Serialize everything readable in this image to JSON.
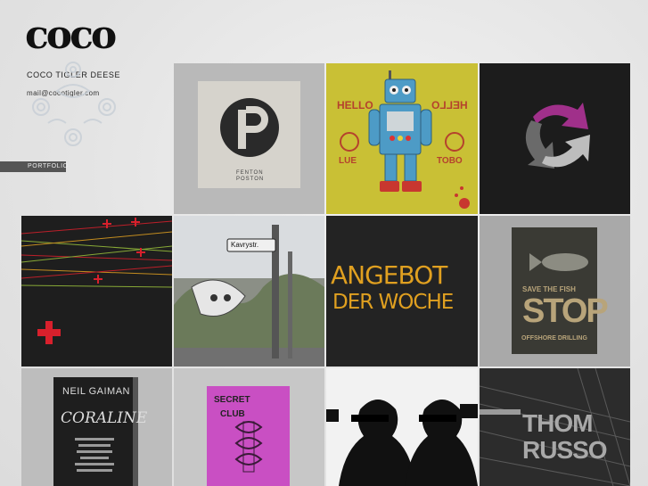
{
  "header": {
    "logo_text": "coco",
    "name": "COCO TIGLER DEESE",
    "email": "mail@cocotigler.com"
  },
  "nav": {
    "items": [
      {
        "label": "PORTFOLIO"
      }
    ]
  },
  "portfolio": {
    "fenton": {
      "line1": "FENTON",
      "line2": "POSTON"
    },
    "robot": {
      "left_top": "HELLO",
      "right_top": "HELLO",
      "left_bottom": "LUE",
      "right_bottom": "TOBO"
    },
    "street_sign": "Kavrystr.",
    "angebot": {
      "line1": "ANGEBOT",
      "line2": "DER WOCHE"
    },
    "fish": {
      "line1": "SAVE THE FISH",
      "line2": "STOP",
      "line3": "OFFSHORE DRILLING"
    },
    "coraline": {
      "author": "NEIL GAIMAN",
      "title": "CORALINE"
    },
    "secret_club": {
      "line1": "SECRET",
      "line2": "CLUB"
    },
    "thom": {
      "line1": "THOM",
      "line2": "RUSSO"
    }
  },
  "colors": {
    "accent_magenta": "#a0308a",
    "accent_red": "#d8202c",
    "robot_bg": "#c9c035",
    "secret_club_pink": "#c94fc3"
  }
}
